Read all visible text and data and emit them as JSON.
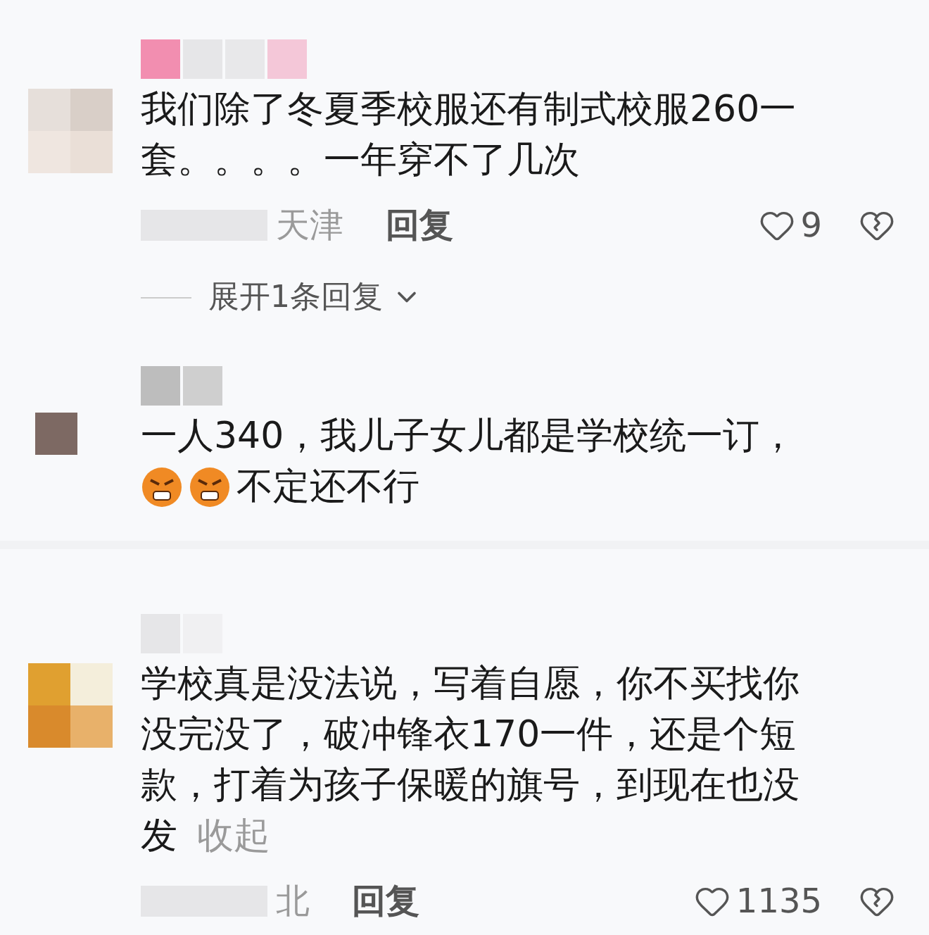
{
  "comments": [
    {
      "lines": [
        {
          "text": "我们除了冬夏季校服还有制式校服260一"
        },
        {
          "text": "套。。。。一年穿不了几次"
        }
      ],
      "meta": {
        "location": "天津",
        "reply": "回复",
        "likes": "9"
      },
      "expand": "展开1条回复"
    },
    {
      "lines": [
        {
          "text": "一人340，我儿子女儿都是学校统一订，"
        },
        {
          "emojis": [
            {
              "kind": "angry-face"
            },
            {
              "kind": "angry-face"
            }
          ],
          "text": "不定还不行"
        }
      ]
    },
    {
      "lines": [
        {
          "text": "学校真是没法说，写着自愿，你不买找你"
        },
        {
          "text": "没完没了，破冲锋衣170一件，还是个短"
        },
        {
          "text": "款，打着为孩子保暖的旗号，到现在也没"
        },
        {
          "text": "发",
          "link": "收起"
        }
      ],
      "meta": {
        "location": "北",
        "reply": "回复",
        "likes": "1135"
      }
    }
  ]
}
